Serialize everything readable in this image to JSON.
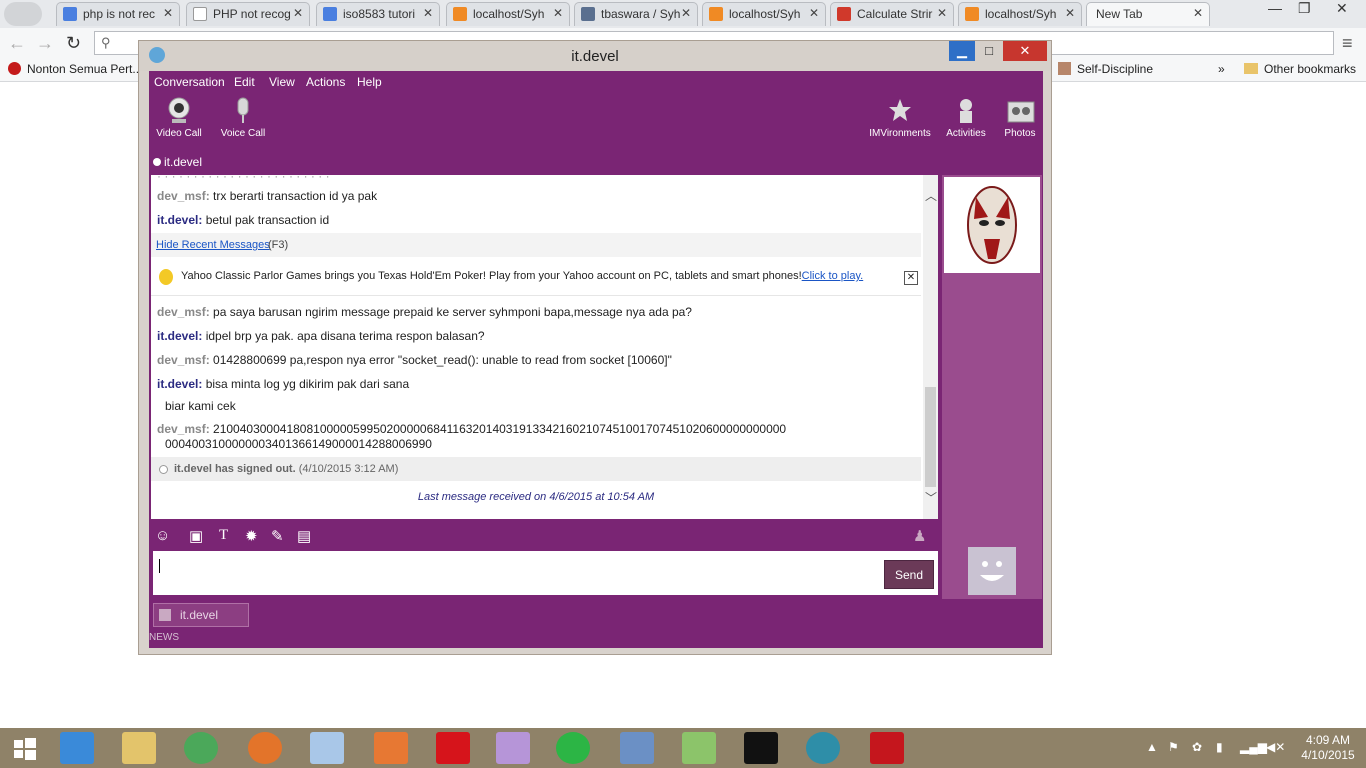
{
  "browser": {
    "tabs": [
      {
        "label": "php is not rec",
        "icon": "google-icon",
        "color": "#4a7fe0"
      },
      {
        "label": "PHP not recog",
        "icon": "page-icon",
        "color": "#ffffff"
      },
      {
        "label": "iso8583 tutori",
        "icon": "google-icon",
        "color": "#4a7fe0"
      },
      {
        "label": "localhost/Syh",
        "icon": "xampp-icon",
        "color": "#f08a24"
      },
      {
        "label": "tbaswara / Syh",
        "icon": "github-icon",
        "color": "#5a6f8f"
      },
      {
        "label": "localhost/Syh",
        "icon": "xampp-icon",
        "color": "#f08a24"
      },
      {
        "label": "Calculate Strir",
        "icon": "s-icon",
        "color": "#d0392b"
      },
      {
        "label": "localhost/Syh",
        "icon": "xampp-icon",
        "color": "#f08a24"
      },
      {
        "label": "New Tab",
        "icon": "",
        "color": ""
      }
    ],
    "bookmarks": [
      {
        "label": "Nonton Semua Pert..."
      },
      {
        "label": "Self-Discipline"
      },
      {
        "label": "»"
      },
      {
        "label": "Other bookmarks"
      }
    ]
  },
  "messenger": {
    "title": "it.devel",
    "menu": [
      "Conversation",
      "Edit",
      "View",
      "Actions",
      "Help"
    ],
    "toolbar_left": [
      {
        "label": "Video Call",
        "icon": "webcam-icon"
      },
      {
        "label": "Voice Call",
        "icon": "microphone-icon"
      }
    ],
    "toolbar_right": [
      {
        "label": "IMVironments",
        "icon": "imvironments-icon"
      },
      {
        "label": "Activities",
        "icon": "activities-icon"
      },
      {
        "label": "Photos",
        "icon": "photos-icon"
      }
    ],
    "presence": "it.devel",
    "messages_top": [
      {
        "who": "dev_msf:",
        "text": "trx berarti transaction id ya pak",
        "sender": "other"
      },
      {
        "who": "it.devel:",
        "text": "betul pak transaction id",
        "sender": "me"
      }
    ],
    "hide_recent": "Hide Recent Messages",
    "hide_recent_key": "(F3)",
    "ad_text": "Yahoo Classic Parlor Games brings you Texas Hold'Em Poker! Play from your Yahoo account on PC, tablets and smart phones!",
    "ad_link": "Click to play.",
    "messages": [
      {
        "who": "dev_msf:",
        "text": "pa saya barusan ngirim message prepaid ke server syhmponi bapa,message nya ada pa?",
        "sender": "other"
      },
      {
        "who": "it.devel:",
        "text": "idpel brp ya pak. apa disana terima respon balasan?",
        "sender": "me"
      },
      {
        "who": "dev_msf:",
        "text": "01428800699 pa,respon nya error \"socket_read(): unable to read from socket [10060]\"",
        "sender": "other"
      },
      {
        "who": "it.devel:",
        "text": "bisa minta log yg dikirim pak dari sana",
        "sender": "me"
      },
      {
        "who": "",
        "text": "biar kami cek",
        "sender": "me"
      },
      {
        "who": "dev_msf:",
        "text": "21004030004180810000059950200000684116320140319133421602107451001707451020600000000000",
        "sender": "other"
      },
      {
        "who": "",
        "text": "0004003100000003401366149000014288006990",
        "sender": "other"
      }
    ],
    "signout_name": "it.devel has signed out.",
    "signout_time": "(4/10/2015 3:12 AM)",
    "last_message": "Last message received on 4/6/2015 at 10:54 AM",
    "send_label": "Send",
    "conv_tab": "it.devel",
    "news": "NEWS"
  },
  "taskbar": {
    "time": "4:09 AM",
    "date": "4/10/2015"
  }
}
